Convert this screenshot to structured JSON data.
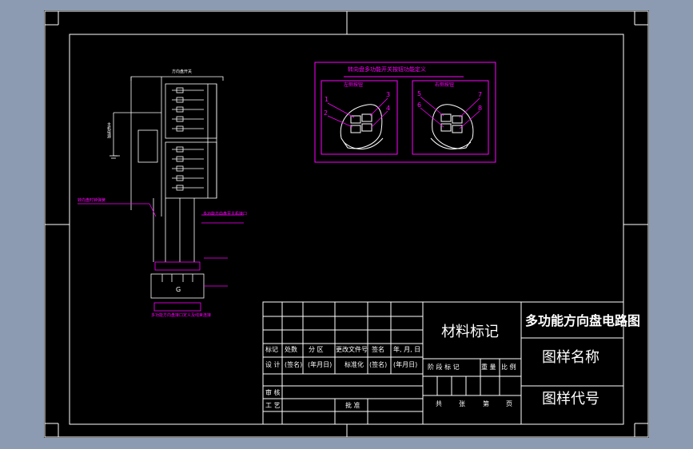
{
  "title_block": {
    "material_mark": "材料标记",
    "drawing_title": "多功能方向盘电路图",
    "drawing_name": "图样名称",
    "drawing_code": "图样代号",
    "row_labels": [
      "标记",
      "处数",
      "分 区",
      "更改文件号",
      "签名",
      "年, 月, 日"
    ],
    "design_row": [
      "设 计",
      "(签名)",
      "(年月日)",
      "标准化",
      "(签名)",
      "(年月日)"
    ],
    "stage_row": [
      "阶 段 标 记",
      "重 量",
      "比 例"
    ],
    "review": "审 核",
    "process": "工 艺",
    "approve": "批 准",
    "sheets_row": [
      "共",
      "张",
      "第",
      "页"
    ]
  },
  "detail_panel": {
    "title": "转向盘多功能开关按钮功能定义",
    "left_caption": "左侧按钮",
    "right_caption": "右侧按钮",
    "left_numbers": [
      "1",
      "2",
      "3",
      "4"
    ],
    "right_numbers": [
      "5",
      "6",
      "7",
      "8"
    ]
  },
  "schematic": {
    "top_label": "方向盘开关",
    "side_label_left": "主机电源",
    "note_left": "转向盘时钟弹簧",
    "note_right": "多功能方向盘至主机接口",
    "bottom_note": "多功能方向盘接口定义及线束连接",
    "connector_label": "G"
  },
  "colors": {
    "line": "#ffffff",
    "accent": "#ff00ff",
    "sheet": "#000000",
    "backdrop": "#8c9bb1"
  }
}
